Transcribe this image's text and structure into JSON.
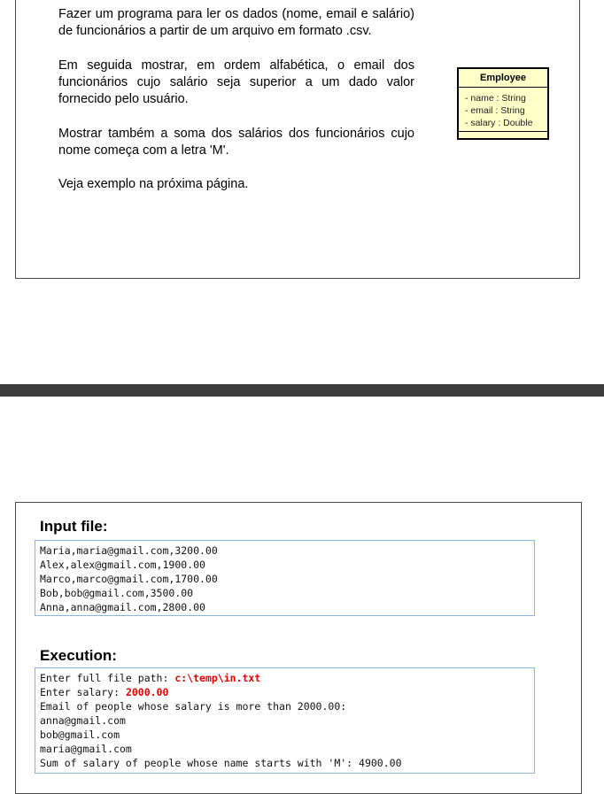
{
  "description": {
    "p1": "Fazer um programa para ler os dados (nome, email e salário) de funcionários a partir de um arquivo em formato .csv.",
    "p2": "Em seguida mostrar, em ordem alfabética, o email dos funcionários cujo salário seja superior a um dado valor fornecido pelo usuário.",
    "p3": "Mostrar também a soma dos salários dos funcionários cujo nome começa com a letra 'M'.",
    "p4": "Veja exemplo na próxima página."
  },
  "uml": {
    "class_name": "Employee",
    "attributes": [
      "- name : String",
      "- email : String",
      "- salary : Double"
    ]
  },
  "input": {
    "heading": "Input file:",
    "lines": [
      "Maria,maria@gmail.com,3200.00",
      "Alex,alex@gmail.com,1900.00",
      "Marco,marco@gmail.com,1700.00",
      "Bob,bob@gmail.com,3500.00",
      "Anna,anna@gmail.com,2800.00"
    ]
  },
  "execution": {
    "heading": "Execution:",
    "prompt_path": "Enter full file path: ",
    "value_path": "c:\\temp\\in.txt",
    "prompt_salary": "Enter salary: ",
    "value_salary": "2000.00",
    "lines": [
      "Email of people whose salary is more than 2000.00:",
      "anna@gmail.com",
      "bob@gmail.com",
      "maria@gmail.com",
      "Sum of salary of people whose name starts with 'M': 4900.00"
    ]
  }
}
